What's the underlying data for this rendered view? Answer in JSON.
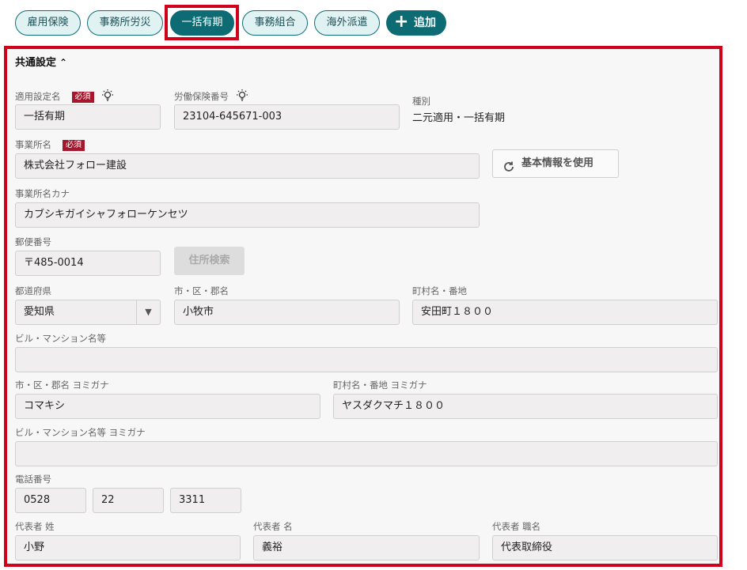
{
  "tabs": [
    {
      "label": "雇用保険"
    },
    {
      "label": "事務所労災"
    },
    {
      "label": "一括有期"
    },
    {
      "label": "事務組合"
    },
    {
      "label": "海外派遣"
    }
  ],
  "add_button": {
    "label": "追加"
  },
  "section": {
    "title": "共通設定"
  },
  "required_badge": "必須",
  "fields": {
    "setting_name": {
      "label": "適用設定名",
      "value": "一括有期"
    },
    "insurance_number": {
      "label": "労働保険番号",
      "value": "23104-645671-003"
    },
    "type": {
      "label": "種別",
      "value": "二元適用・一括有期"
    },
    "office_name": {
      "label": "事業所名",
      "value": "株式会社フォロー建設"
    },
    "office_kana": {
      "label": "事業所名カナ",
      "value": "カブシキガイシャフォローケンセツ"
    },
    "postal_code": {
      "label": "郵便番号",
      "value": "〒485-0014"
    },
    "prefecture": {
      "label": "都道府県",
      "value": "愛知県"
    },
    "city": {
      "label": "市・区・郡名",
      "value": "小牧市"
    },
    "town": {
      "label": "町村名・番地",
      "value": "安田町１８００"
    },
    "building": {
      "label": "ビル・マンション名等",
      "value": ""
    },
    "city_kana": {
      "label": "市・区・郡名 ヨミガナ",
      "value": "コマキシ"
    },
    "town_kana": {
      "label": "町村名・番地 ヨミガナ",
      "value": "ヤスダクマチ１８００"
    },
    "building_kana": {
      "label": "ビル・マンション名等 ヨミガナ",
      "value": ""
    },
    "phone": {
      "label": "電話番号",
      "part1": "0528",
      "part2": "22",
      "part3": "3311"
    },
    "rep_last": {
      "label": "代表者 姓",
      "value": "小野"
    },
    "rep_first": {
      "label": "代表者 名",
      "value": "義裕"
    },
    "rep_title": {
      "label": "代表者 職名",
      "value": "代表取締役"
    }
  },
  "buttons": {
    "use_basic_info": "基本情報を使用",
    "address_search": "住所検索"
  },
  "icons": {
    "hint": "lightbulb-icon",
    "refresh": "refresh-icon",
    "dropdown": "chevron-down-icon",
    "collapse": "chevron-up-icon",
    "add": "plus-icon"
  },
  "colors": {
    "accent": "#0d6b74",
    "tab_bg": "#e1f2f3",
    "required": "#a6162c",
    "highlight": "#d0021b"
  }
}
